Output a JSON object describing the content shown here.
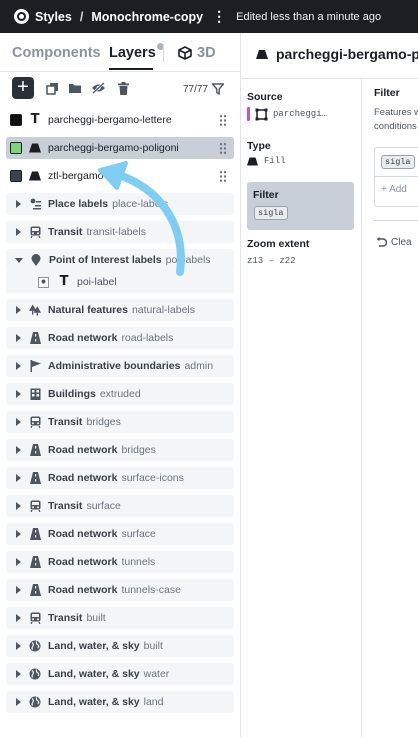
{
  "topbar": {
    "app": "Styles",
    "style_name": "Monochrome-copy",
    "status": "Edited less than a minute ago"
  },
  "tabs": {
    "components": "Components",
    "layers": "Layers",
    "three_d": "3D"
  },
  "toolbar": {
    "count": "77/77"
  },
  "layers": [
    {
      "name": "parcheggi-bergamo-lettere",
      "type": "symbol-text",
      "swatch": "#111111",
      "selected": false
    },
    {
      "name": "parcheggi-bergamo-poligoni",
      "type": "fill",
      "swatch": "#7ed67a",
      "selected": true
    },
    {
      "name": "ztl-bergamo",
      "type": "fill",
      "swatch": "#3c4250",
      "selected": false
    }
  ],
  "groups": [
    {
      "name": "Place labels",
      "sub": "place-labels",
      "icon": "place-labels-icon",
      "expanded": false
    },
    {
      "name": "Transit",
      "sub": "transit-labels",
      "icon": "transit-icon",
      "expanded": false
    },
    {
      "name": "Point of Interest labels",
      "sub": "poi-labels",
      "icon": "poi-pin-icon",
      "expanded": true,
      "children": [
        {
          "name": "poi-label"
        }
      ]
    },
    {
      "name": "Natural features",
      "sub": "natural-labels",
      "icon": "trees-icon",
      "expanded": false
    },
    {
      "name": "Road network",
      "sub": "road-labels",
      "icon": "road-icon",
      "expanded": false
    },
    {
      "name": "Administrative boundaries",
      "sub": "admin",
      "icon": "flag-icon",
      "expanded": false
    },
    {
      "name": "Buildings",
      "sub": "extruded",
      "icon": "building-icon",
      "expanded": false
    },
    {
      "name": "Transit",
      "sub": "bridges",
      "icon": "transit-icon",
      "expanded": false
    },
    {
      "name": "Road network",
      "sub": "bridges",
      "icon": "road-icon",
      "expanded": false
    },
    {
      "name": "Road network",
      "sub": "surface-icons",
      "icon": "road-icon",
      "expanded": false
    },
    {
      "name": "Transit",
      "sub": "surface",
      "icon": "transit-icon",
      "expanded": false
    },
    {
      "name": "Road network",
      "sub": "surface",
      "icon": "road-icon",
      "expanded": false
    },
    {
      "name": "Road network",
      "sub": "tunnels",
      "icon": "road-icon",
      "expanded": false
    },
    {
      "name": "Road network",
      "sub": "tunnels-case",
      "icon": "road-icon",
      "expanded": false
    },
    {
      "name": "Transit",
      "sub": "built",
      "icon": "transit-icon",
      "expanded": false
    },
    {
      "name": "Land, water, & sky",
      "sub": "built",
      "icon": "globe-icon",
      "expanded": false
    },
    {
      "name": "Land, water, & sky",
      "sub": "water",
      "icon": "globe-icon",
      "expanded": false
    },
    {
      "name": "Land, water, & sky",
      "sub": "land",
      "icon": "globe-icon",
      "expanded": false
    }
  ],
  "panel": {
    "title": "parcheggi-bergamo-p",
    "source_label": "Source",
    "source_value": "parcheggi…",
    "source_color": "#c651c9",
    "type_label": "Type",
    "type_value": "Fill",
    "filter_label": "Filter",
    "filter_chip": "sigla",
    "zoom_label": "Zoom extent",
    "zoom_value": "z13 – z22"
  },
  "filter_editor": {
    "title": "Filter",
    "desc_line1": "Features w",
    "desc_line2": "conditions",
    "chip": "sigla",
    "add_label": "Add",
    "clear_label": "Clea"
  },
  "colors": {
    "topbar": "#1d1e24",
    "selected_row": "#c9cfd8",
    "annotation_arrow": "#7fcdf2"
  }
}
